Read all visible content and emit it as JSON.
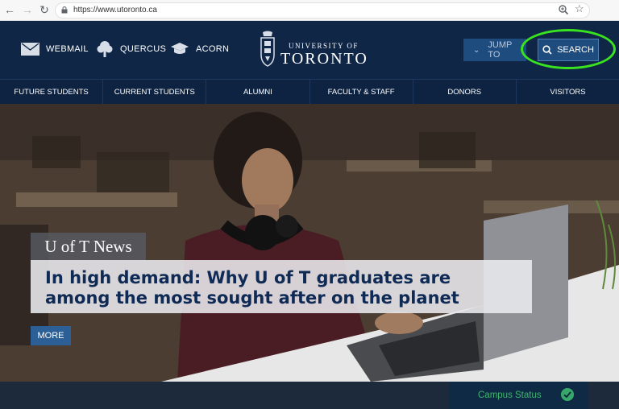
{
  "browser": {
    "url": "https://www.utoronto.ca",
    "back_icon": "back-arrow-icon",
    "forward_icon": "forward-arrow-icon",
    "reload_icon": "reload-icon"
  },
  "header": {
    "quick_links": [
      {
        "label": "WEBMAIL",
        "icon": "mail-icon"
      },
      {
        "label": "QUERCUS",
        "icon": "tree-icon"
      },
      {
        "label": "ACORN",
        "icon": "grad-cap-icon"
      }
    ],
    "logo": {
      "small": "UNIVERSITY OF",
      "big": "TORONTO"
    },
    "jump_to": "JUMP TO",
    "search": "SEARCH"
  },
  "nav": {
    "items": [
      "FUTURE STUDENTS",
      "CURRENT STUDENTS",
      "ALUMNI",
      "FACULTY & STAFF",
      "DONORS",
      "VISITORS"
    ]
  },
  "hero": {
    "tag": "U of T News",
    "headline": "In high demand: Why U of T graduates are among the most sought after on the planet",
    "more": "MORE"
  },
  "footer": {
    "campus_status": "Campus Status"
  },
  "colors": {
    "header_bg": "#0f2646",
    "accent_blue": "#1f4c7e",
    "highlight_green": "#39e31f",
    "status_green": "#37a86a"
  }
}
